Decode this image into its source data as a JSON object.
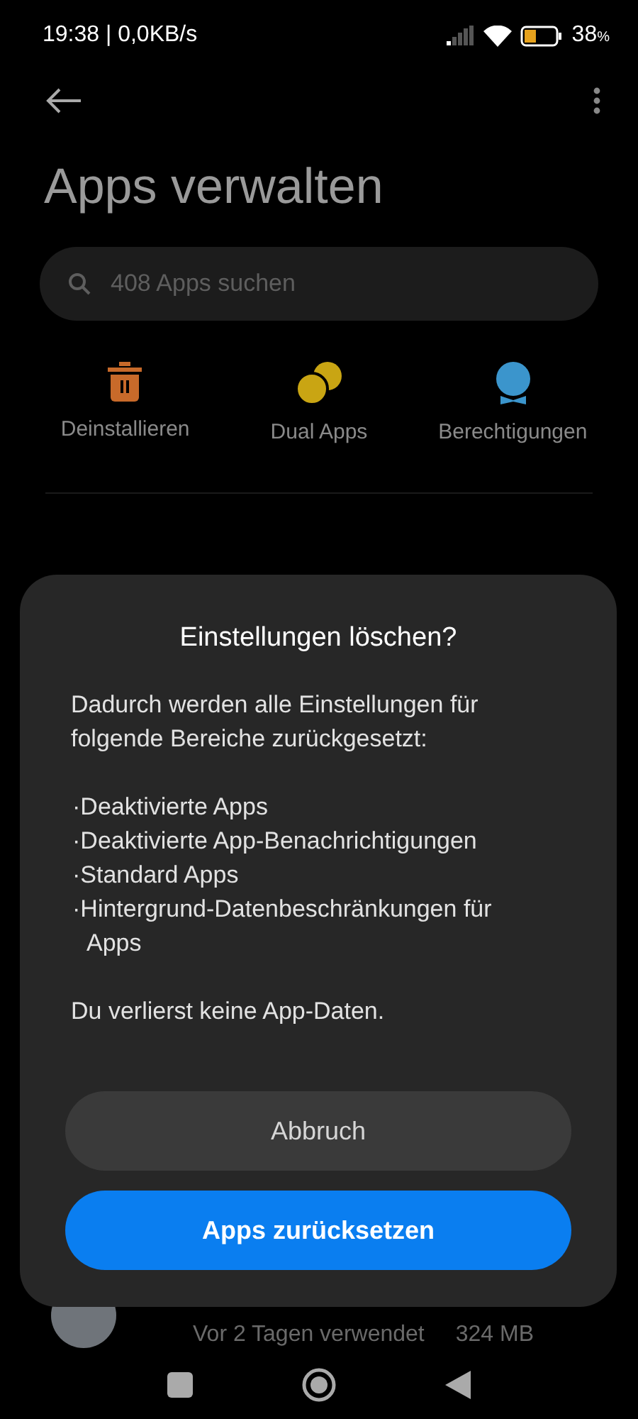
{
  "status_bar": {
    "time": "19:38 | 0,0KB/s",
    "battery": "38",
    "battery_unit": "%"
  },
  "title": "Apps verwalten",
  "search": {
    "placeholder": "408 Apps suchen"
  },
  "shortcuts": [
    {
      "label": "Deinstallieren",
      "kind": "trash"
    },
    {
      "label": "Dual Apps",
      "kind": "dual"
    },
    {
      "label": "Berechtigungen",
      "kind": "badge"
    }
  ],
  "app_row": {
    "usage": "Vor 2 Tagen verwendet",
    "size": "324 MB"
  },
  "dialog": {
    "title": "Einstellungen löschen?",
    "intro": "Dadurch werden alle Einstellungen für folgende Bereiche zurückgesetzt:",
    "items": [
      "·Deaktivierte Apps",
      "·Deaktivierte App-Benachrichtigungen",
      "·Standard Apps",
      "·Hintergrund-Datenbeschränkungen für Apps"
    ],
    "note": "Du verlierst keine App-Daten.",
    "buttons": [
      {
        "label": "Abbruch",
        "kind": "secondary"
      },
      {
        "label": "Apps zurücksetzen",
        "kind": "primary"
      }
    ]
  }
}
